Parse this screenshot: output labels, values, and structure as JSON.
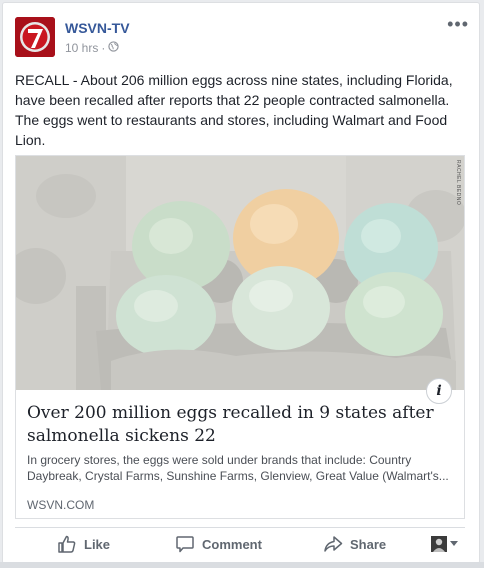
{
  "post": {
    "page_name": "WSVN-TV",
    "time": "10 hrs",
    "separator": "·",
    "text": "RECALL - About 206 million eggs across nine states, including Florida, have been recalled after reports that 22 people contracted salmonella. The eggs went to restaurants and stores, including Walmart and Food Lion.",
    "more_icon": "more-horizontal-icon"
  },
  "card": {
    "image_credit": "RACHEL BEDNO",
    "title": "Over 200 million eggs recalled in 9 states after salmonella sickens 22",
    "description": "In grocery stores, the eggs were sold under brands that include: Country Daybreak, Crystal Farms, Sunshine Farms, Glenview, Great Value (Walmart's...",
    "domain": "WSVN.COM",
    "info_label": "i"
  },
  "actions": {
    "like": "Like",
    "comment": "Comment",
    "share": "Share"
  },
  "colors": {
    "link": "#365899",
    "text": "#1d2129",
    "muted": "#606770"
  }
}
